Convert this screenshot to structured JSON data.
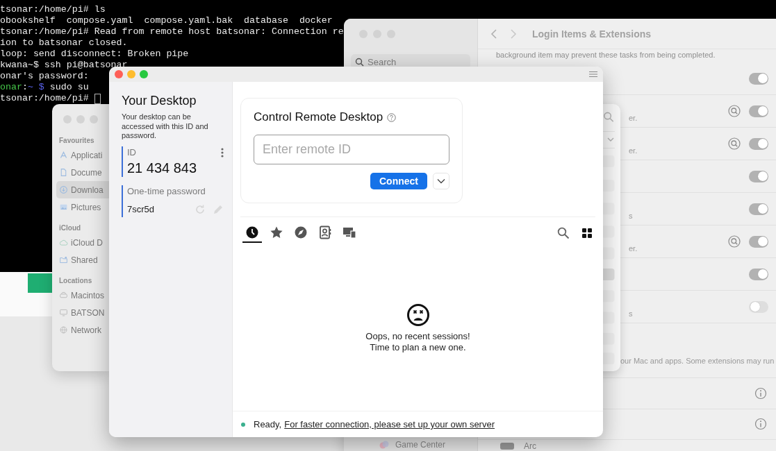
{
  "terminal": {
    "lines": [
      {
        "segments": [
          {
            "kind": "plain",
            "text": "tsonar:/home/pi# ls"
          }
        ],
        "cursor": false
      },
      {
        "segments": [
          {
            "kind": "plain",
            "text": "obookshelf  compose.yaml  compose.yaml.bak  database  docker"
          }
        ],
        "cursor": false
      },
      {
        "segments": [
          {
            "kind": "plain",
            "text": "tsonar:/home/pi# Read from remote host batsonar: Connection re"
          }
        ],
        "cursor": false
      },
      {
        "segments": [
          {
            "kind": "plain",
            "text": "ion to batsonar closed."
          }
        ],
        "cursor": false
      },
      {
        "segments": [
          {
            "kind": "plain",
            "text": "loop: send disconnect: Broken pipe"
          }
        ],
        "cursor": false
      },
      {
        "segments": [
          {
            "kind": "plain",
            "text": "kwana~$ ssh pi@batsonar"
          }
        ],
        "cursor": false
      },
      {
        "segments": [
          {
            "kind": "plain",
            "text": "onar's password:"
          }
        ],
        "cursor": false
      },
      {
        "segments": [
          {
            "kind": "host",
            "text": "onar"
          },
          {
            "kind": "plain",
            "text": ":"
          },
          {
            "kind": "path",
            "text": "~ $"
          },
          {
            "kind": "plain",
            "text": " sudo su"
          }
        ],
        "cursor": false
      },
      {
        "segments": [
          {
            "kind": "plain",
            "text": "tsonar:/home/pi# "
          }
        ],
        "cursor": true
      }
    ]
  },
  "finder": {
    "sections": [
      {
        "header": "Favourites",
        "items": [
          {
            "kind": "apps",
            "label": "Applicati",
            "selected": false
          },
          {
            "kind": "document",
            "label": "Docume",
            "selected": false
          },
          {
            "kind": "download",
            "label": "Downloa",
            "selected": true
          },
          {
            "kind": "pictures",
            "label": "Pictures",
            "selected": false
          }
        ]
      },
      {
        "header": "iCloud",
        "items": [
          {
            "kind": "cloud",
            "label": "iCloud D",
            "selected": false
          },
          {
            "kind": "shared",
            "label": "Shared",
            "selected": false
          }
        ]
      },
      {
        "header": "Locations",
        "items": [
          {
            "kind": "disk",
            "label": "Macintos",
            "selected": false
          },
          {
            "kind": "computer",
            "label": "BATSON",
            "selected": false
          },
          {
            "kind": "network",
            "label": "Network",
            "selected": false
          }
        ]
      }
    ]
  },
  "settings": {
    "title": "Login Items & Extensions",
    "search": {
      "placeholder": "Search"
    },
    "sidebar_item": {
      "label": "Game Center"
    },
    "intro": "background item may prevent these tasks from being completed.",
    "rows": [
      {
        "text": "",
        "inspect": false,
        "on": true
      },
      {
        "text": "er.",
        "inspect": true,
        "on": true
      },
      {
        "text": "er.",
        "inspect": true,
        "on": true
      },
      {
        "text": "",
        "inspect": false,
        "on": true
      },
      {
        "text": "s",
        "inspect": false,
        "on": true
      },
      {
        "text": "er.",
        "inspect": true,
        "on": true
      },
      {
        "text": "",
        "inspect": false,
        "on": true
      },
      {
        "text": "s",
        "inspect": false,
        "on": false
      }
    ],
    "extensions_note": "our Mac and apps. Some extensions may run",
    "bottom_item": {
      "label": "Arc"
    }
  },
  "rustdesk": {
    "your_desktop": {
      "title": "Your Desktop",
      "description": "Your desktop can be accessed with this ID and password.",
      "id_label": "ID",
      "id": "21 434 843",
      "password_label": "One-time password",
      "password": "7scr5d"
    },
    "control": {
      "title": "Control Remote Desktop",
      "placeholder": "Enter remote ID",
      "connect": "Connect"
    },
    "tabs": [
      {
        "kind": "recent",
        "selected": true
      },
      {
        "kind": "favorites",
        "selected": false
      },
      {
        "kind": "discovered",
        "selected": false
      },
      {
        "kind": "address_book",
        "selected": false
      },
      {
        "kind": "group",
        "selected": false
      }
    ],
    "empty_message": "Oops, no recent sessions!\nTime to plan a new one.",
    "status": {
      "text": "Ready,",
      "link": "For faster connection, please set up your own server"
    }
  }
}
